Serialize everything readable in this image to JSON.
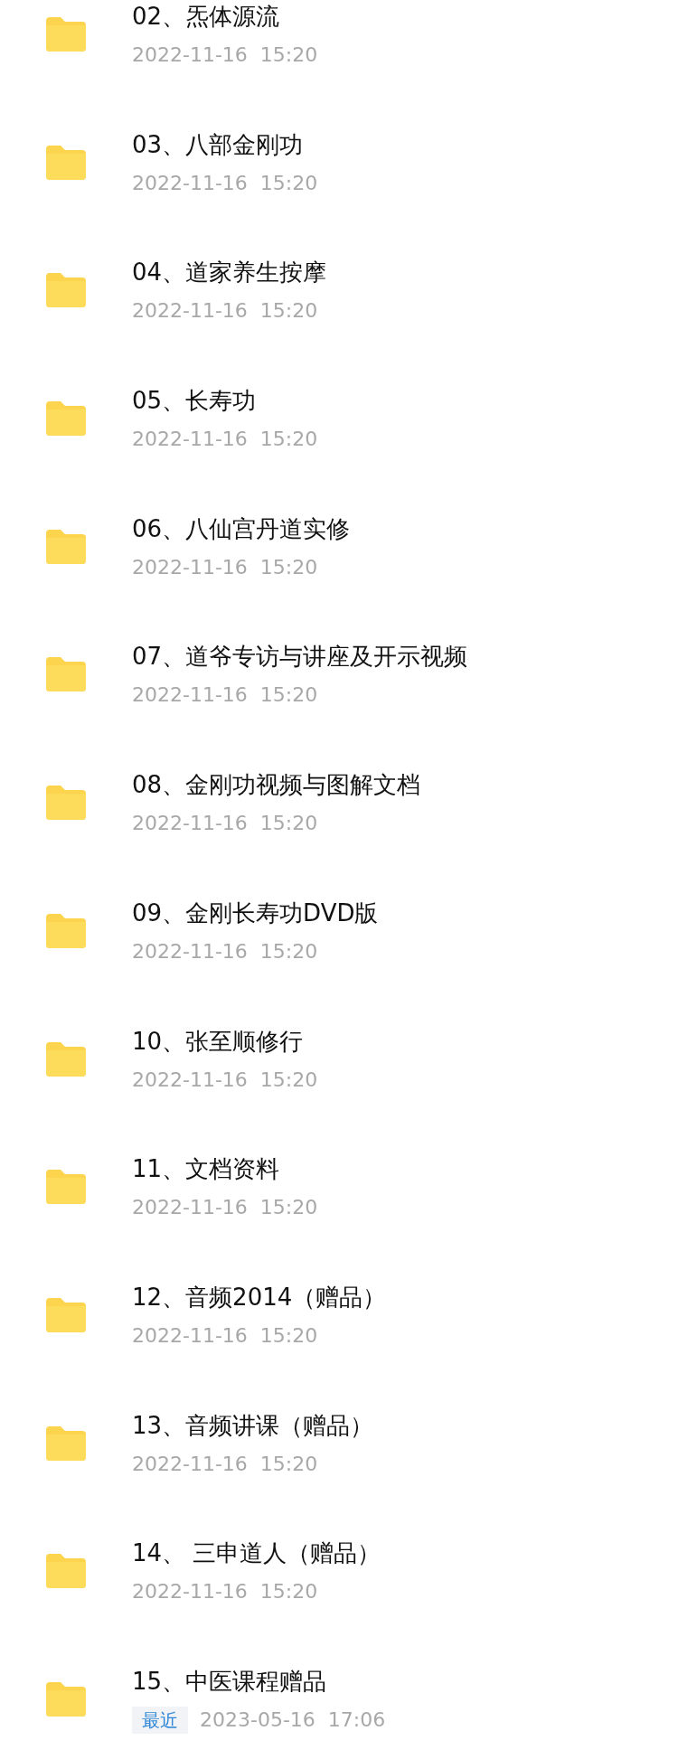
{
  "files": [
    {
      "name": "02、炁体源流",
      "date": "2022-11-16  15:20"
    },
    {
      "name": "03、八部金刚功",
      "date": "2022-11-16  15:20"
    },
    {
      "name": "04、道家养生按摩",
      "date": "2022-11-16  15:20"
    },
    {
      "name": "05、长寿功",
      "date": "2022-11-16  15:20"
    },
    {
      "name": "06、八仙宫丹道实修",
      "date": "2022-11-16  15:20"
    },
    {
      "name": "07、道爷专访与讲座及开示视频",
      "date": "2022-11-16  15:20"
    },
    {
      "name": "08、金刚功视频与图解文档",
      "date": "2022-11-16  15:20"
    },
    {
      "name": "09、金刚长寿功DVD版",
      "date": "2022-11-16  15:20"
    },
    {
      "name": "10、张至顺修行",
      "date": "2022-11-16  15:20"
    },
    {
      "name": "11、文档资料",
      "date": "2022-11-16  15:20"
    },
    {
      "name": "12、音频2014（赠品）",
      "date": "2022-11-16  15:20"
    },
    {
      "name": "13、音频讲课（赠品）",
      "date": "2022-11-16  15:20"
    },
    {
      "name": "14、 三申道人（赠品）",
      "date": "2022-11-16  15:20"
    },
    {
      "name": "15、中医课程赠品",
      "tag": "最近",
      "date": "2023-05-16  17:06"
    }
  ]
}
